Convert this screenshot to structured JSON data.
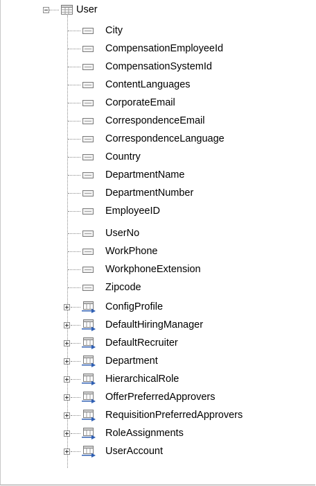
{
  "tree": {
    "root": {
      "label": "User",
      "icon": "table-icon",
      "expanded": true
    },
    "fields": [
      "City",
      "CompensationEmployeeId",
      "CompensationSystemId",
      "ContentLanguages",
      "CorporateEmail",
      "CorrespondenceEmail",
      "CorrespondenceLanguage",
      "Country",
      "DepartmentName",
      "DepartmentNumber",
      "EmployeeID",
      "UserNo",
      "WorkPhone",
      "WorkphoneExtension",
      "Zipcode"
    ],
    "relations": [
      "ConfigProfile",
      "DefaultHiringManager",
      "DefaultRecruiter",
      "Department",
      "HierarchicalRole",
      "OfferPreferredApprovers",
      "RequisitionPreferredApprovers",
      "RoleAssignments",
      "UserAccount"
    ],
    "field_icon_name": "field-icon",
    "relation_icon_name": "relation-icon",
    "colors": {
      "line": "#8a8a8a",
      "icon_border": "#7a7a7a",
      "icon_fill": "#f2f2f2",
      "relation_blue": "#2f5fb3"
    }
  }
}
